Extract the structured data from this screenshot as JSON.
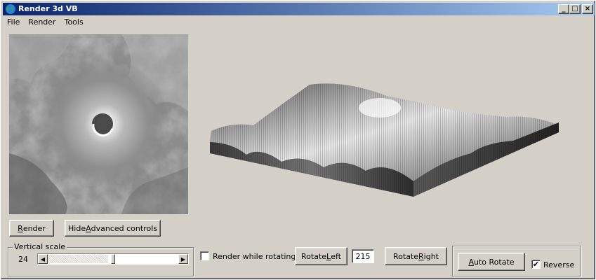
{
  "window": {
    "title": "Render 3d VB"
  },
  "titlebar_buttons": {
    "minimize": "_",
    "maximize": "□",
    "close": "×"
  },
  "menu": [
    "File",
    "Render",
    "Tools"
  ],
  "buttons": {
    "render": {
      "before": "",
      "accel": "R",
      "after": "ender"
    },
    "hide_advanced": {
      "before": "Hide ",
      "accel": "A",
      "after": "dvanced controls"
    },
    "rotate_left": {
      "before": "Rotate ",
      "accel": "L",
      "after": "eft"
    },
    "rotate_right": {
      "before": "Rotate ",
      "accel": "R",
      "after": "ight"
    },
    "auto_rotate": {
      "before": "",
      "accel": "A",
      "after": "uto Rotate"
    }
  },
  "vertical_scale": {
    "label": "Vertical scale",
    "value": "24",
    "slider_fraction": 0.5
  },
  "render_while_rotating": {
    "label": "Render while rotating",
    "checked": false
  },
  "rotation_angle": "215",
  "reverse": {
    "label": "Reverse",
    "checked": true,
    "check_glyph": "✔"
  },
  "icons": {
    "app": "globe-icon",
    "left_arrow": "◀",
    "right_arrow": "▶"
  }
}
